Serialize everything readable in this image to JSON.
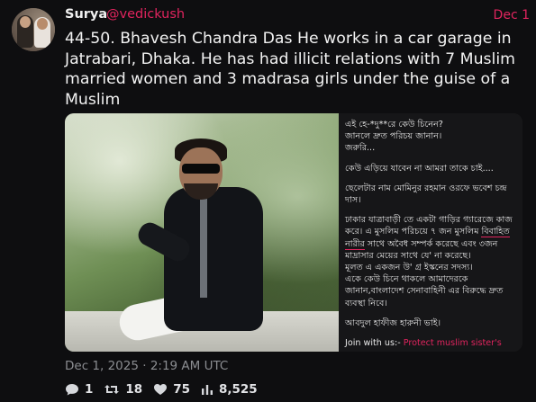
{
  "author": {
    "name": "Surya",
    "handle": "@vedickush",
    "date": "Dec 1"
  },
  "post": {
    "text": "44-50. Bhavesh Chandra Das He works in a car garage in Jatrabari, Dhaka. He has had illicit relations with 7 Muslim married women and 3 madrasa girls under the guise of a Muslim",
    "timestamp": "Dec 1, 2025 · 2:19 AM UTC"
  },
  "image_text": {
    "p1": "এই হে-*দু**রে কেউ চিনেন?\nজানলে দ্রুত পরিচয় জানান।\nজরুরি...",
    "p2": "কেউ এড়িয়ে যাবেন না আমরা তাকে চাই....",
    "p3": "ছেলেটার নাম মোমিনুর রহমান ওরফে ভবেশ চন্দ্র দাস।",
    "p4a": "ঢাকার যাত্রাবাড়ী তে একটা গাড়ির গ্যারেজে কাজ করে। এ মুসলিম পরিচয়ে ৭ জন মুসলিম ",
    "p4hl": "বিবাহিত নারীর",
    "p4b": " সাথে অবৈধ সম্পর্ক করেছে এবং ৩জন মাদ্রাসার মেয়ের সাথে যে' না করেছে।\nমূলত এ একজন উ' গ্র ইস্কনের সদস্য।\nএকে কেউ চিনে থাকলে আমাদেরকে জানান,বাংলাদেশ সেনাবাহিনী এর বিরুদ্ধে দ্রুত ব্যবস্থা নিবে।",
    "p5": "আবদুল হাফীজ হারুনী ভাই।",
    "join_prefix": "Join with us:- ",
    "join_link": "Protect muslim sister's"
  },
  "stats": {
    "replies": "1",
    "retweets": "18",
    "likes": "75",
    "views": "8,525"
  },
  "colors": {
    "accent": "#e0245e",
    "background": "#0e0e10",
    "muted": "#8b8d91"
  },
  "icons": [
    "comment-icon",
    "retweet-icon",
    "heart-icon",
    "views-icon"
  ]
}
